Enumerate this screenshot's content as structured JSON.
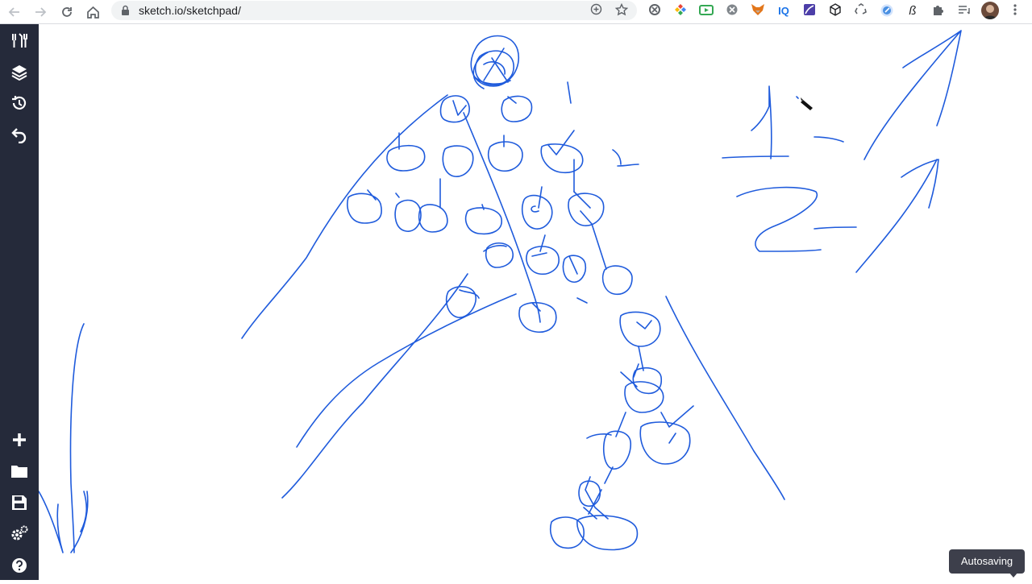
{
  "browser": {
    "url": "sketch.io/sketchpad/",
    "nav_icons": [
      "back-icon",
      "forward-icon",
      "reload-icon",
      "home-icon"
    ],
    "url_actions": [
      "add-icon",
      "star-icon"
    ],
    "extensions": [
      "ext-gear",
      "ext-colorful",
      "ext-green",
      "ext-gray",
      "ext-fox",
      "ext-iq",
      "ext-flag",
      "ext-cube",
      "ext-recycle",
      "ext-blue",
      "ext-beta",
      "ext-puzzle",
      "ext-list",
      "avatar",
      "menu-dots"
    ],
    "ext_text": {
      "iq": "IQ",
      "beta": "ß"
    }
  },
  "sidebar": {
    "top": [
      "tools-icon",
      "layers-icon",
      "history-icon",
      "undo-icon"
    ],
    "bottom": [
      "add-icon",
      "folder-icon",
      "save-icon",
      "settings-icon",
      "help-icon"
    ]
  },
  "canvas": {
    "stroke_color": "#1f5bdc",
    "labels": {
      "one_small": "1",
      "two_small": "2"
    }
  },
  "toast": {
    "text": "Autosaving"
  }
}
